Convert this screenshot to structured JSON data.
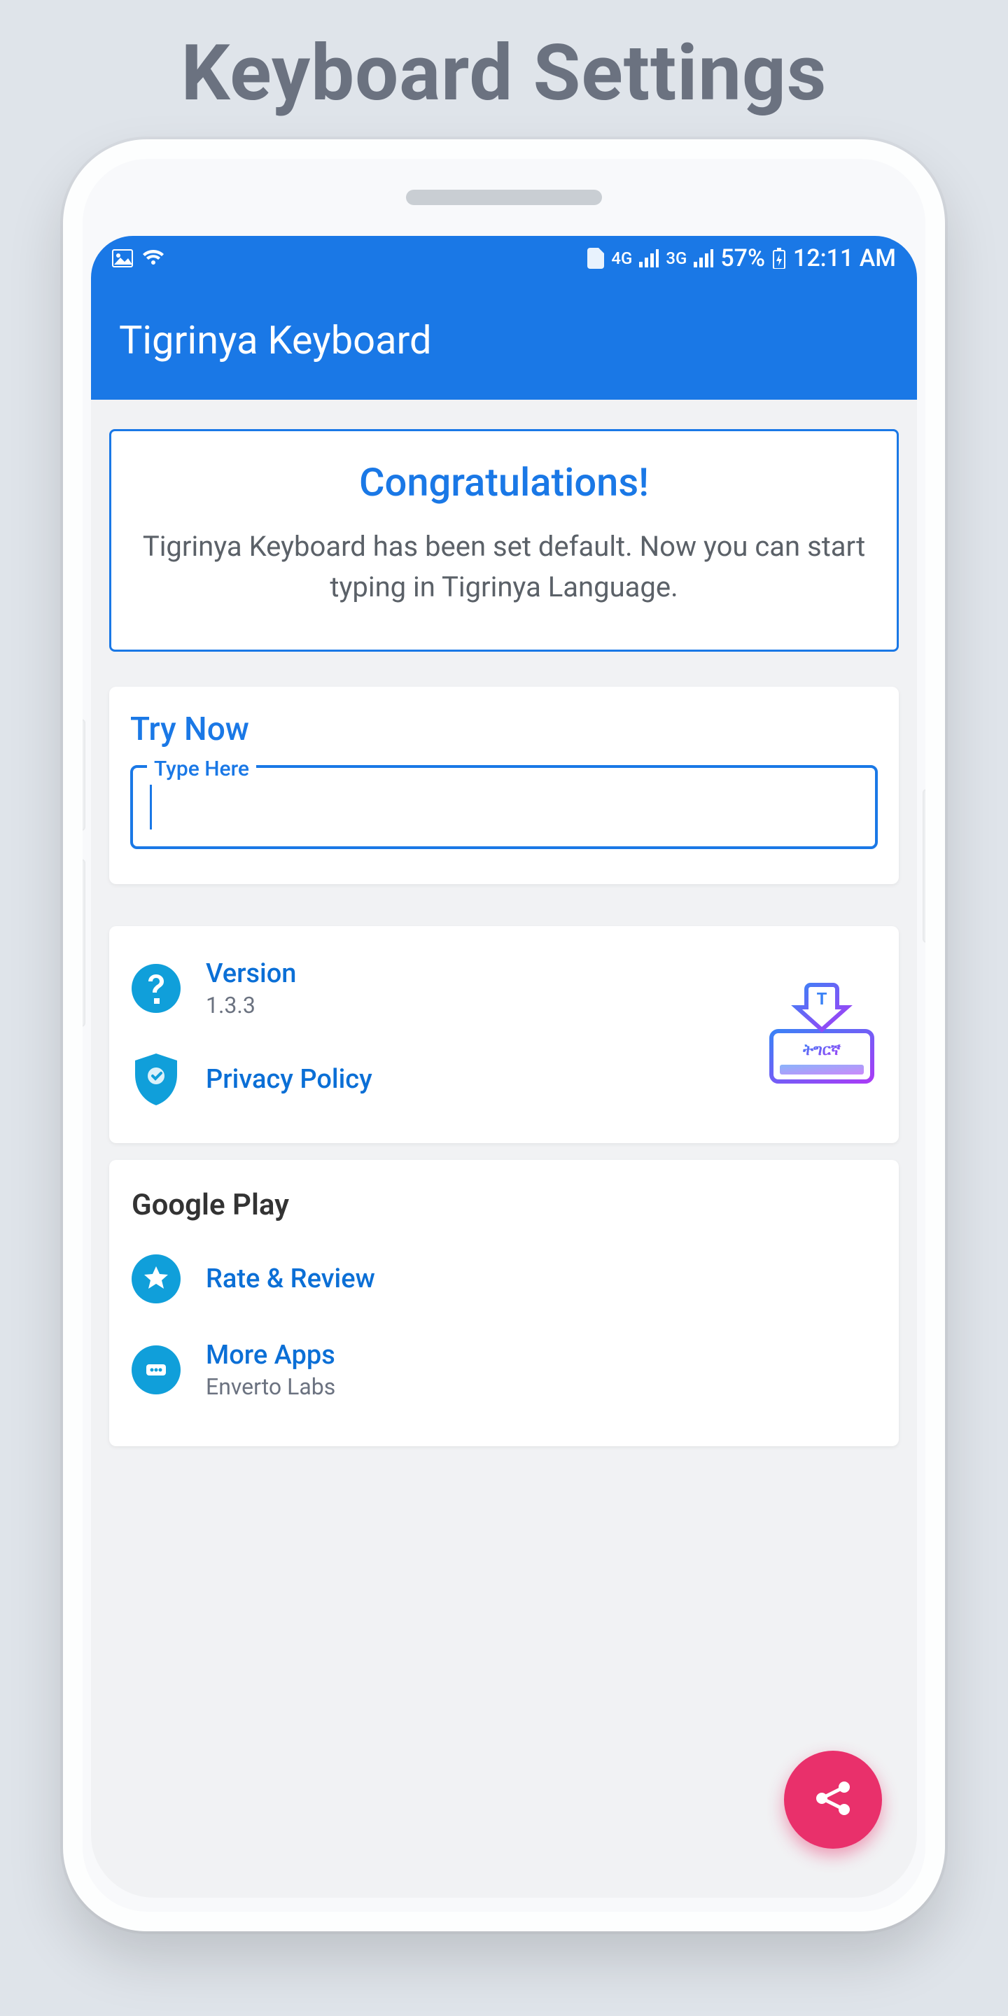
{
  "page_heading": "Keyboard Settings",
  "statusbar": {
    "network1": "4G",
    "network2": "3G",
    "battery": "57%",
    "time": "12:11 AM"
  },
  "appbar": {
    "title": "Tigrinya Keyboard"
  },
  "congrats": {
    "title": "Congratulations!",
    "message": "Tigrinya Keyboard has been set default. Now you can start typing in Tigrinya Language."
  },
  "try": {
    "section_label": "Try Now",
    "input_label": "Type Here",
    "input_value": ""
  },
  "info": {
    "version": {
      "label": "Version",
      "value": "1.3.3"
    },
    "privacy": {
      "label": "Privacy Policy"
    }
  },
  "googleplay": {
    "section_title": "Google Play",
    "rate": {
      "label": "Rate & Review"
    },
    "more": {
      "label": "More Apps",
      "subtitle": "Enverto Labs"
    }
  },
  "app_icon": {
    "letter": "T",
    "script": "ትግርኛ"
  }
}
